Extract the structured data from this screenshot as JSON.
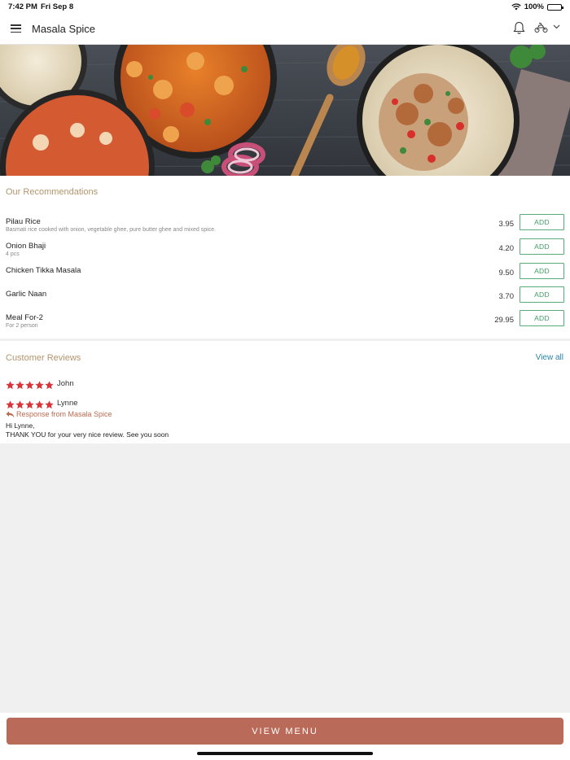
{
  "status_bar": {
    "time": "7:42 PM",
    "date": "Fri Sep 8",
    "battery": "100%",
    "battery_level": 1.0
  },
  "header": {
    "title": "Masala Spice",
    "icons": [
      "menu-icon",
      "bell-icon",
      "scooter-icon",
      "chevron-down-icon"
    ]
  },
  "recommendations": {
    "title": "Our Recommendations",
    "add_label": "ADD",
    "items": [
      {
        "name": "Pilau Rice",
        "description": "Basmati rice cooked with onion, vegetable ghee, pure butter ghee and mixed spice.",
        "price": "3.95"
      },
      {
        "name": "Onion Bhaji",
        "description": "4 pcs",
        "price": "4.20"
      },
      {
        "name": "Chicken Tikka Masala",
        "description": "",
        "price": "9.50"
      },
      {
        "name": "Garlic Naan",
        "description": "",
        "price": "3.70"
      },
      {
        "name": "Meal For-2",
        "description": "For 2 person",
        "price": "29.95"
      }
    ]
  },
  "reviews": {
    "title": "Customer Reviews",
    "view_all": "View all",
    "items": [
      {
        "name": "John",
        "rating": 5
      },
      {
        "name": "Lynne",
        "rating": 5,
        "response_label": "Response from Masala Spice",
        "response_line1": "Hi Lynne,",
        "response_line2": "THANK YOU for your very nice review. See you soon"
      }
    ]
  },
  "footer": {
    "button": "VIEW MENU"
  },
  "colors": {
    "accent": "#b96a58",
    "add_green": "#3e9e63",
    "section_title": "#b3956d",
    "link": "#2a86a8",
    "star": "#d9343a"
  }
}
